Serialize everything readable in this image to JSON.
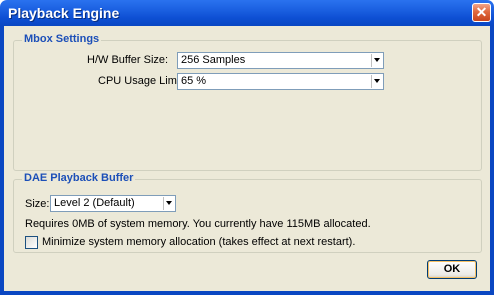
{
  "window": {
    "title": "Playback Engine",
    "close_glyph": "✕"
  },
  "mbox": {
    "title": "Mbox Settings",
    "buffer_label": "H/W Buffer Size:",
    "buffer_value": "256 Samples",
    "cpu_label": "CPU Usage Limit:",
    "cpu_value": "65 %"
  },
  "dae": {
    "title": "DAE Playback Buffer",
    "size_label": "Size:",
    "size_value": "Level 2 (Default)",
    "memory_info": "Requires 0MB of system memory. You currently have 115MB allocated.",
    "minimize_label": "Minimize system memory allocation (takes effect at next restart).",
    "minimize_checked": false
  },
  "buttons": {
    "ok": "OK"
  }
}
